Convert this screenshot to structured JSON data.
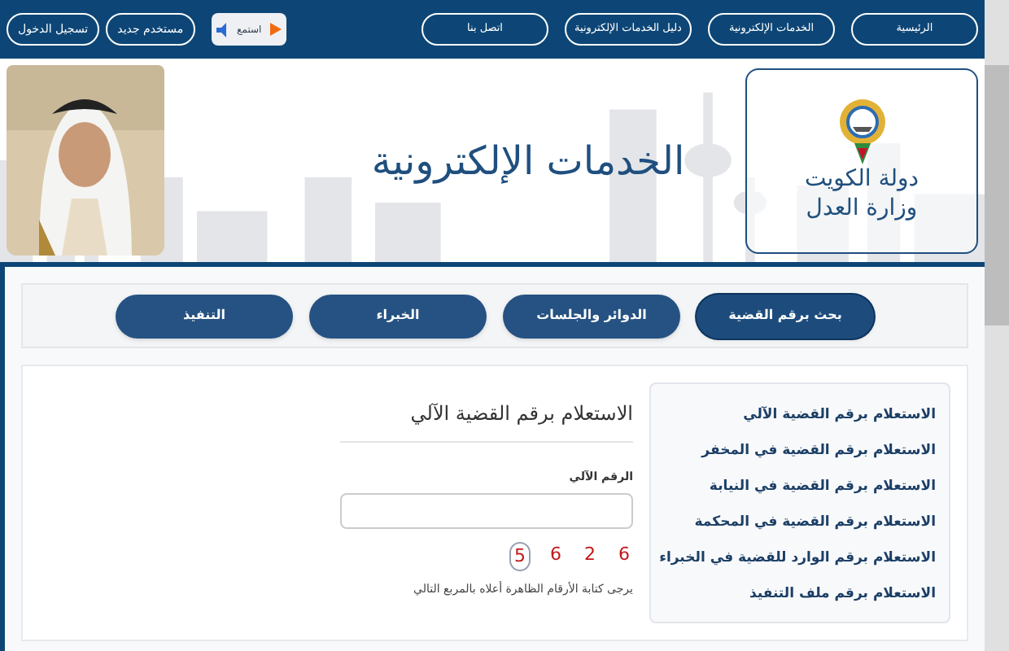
{
  "top_bar": {
    "nav": [
      "الرئيسية",
      "الخدمات الإلكترونية",
      "دليل الخدمات الإلكترونية",
      "اتصل بنا"
    ],
    "listen": "استمع",
    "account": [
      "مستخدم جديد",
      "تسجيل الدخول"
    ]
  },
  "header": {
    "logo_lines": [
      "دولة الكويت",
      "وزارة العدل"
    ],
    "title": "الخدمات الإلكترونية"
  },
  "tabs": [
    {
      "label": "بحث برقم القضية",
      "selected": true
    },
    {
      "label": "الدوائر والجلسات",
      "selected": false
    },
    {
      "label": "الخبراء",
      "selected": false
    },
    {
      "label": "التنفيذ",
      "selected": false
    }
  ],
  "sidebar": {
    "items": [
      "الاستعلام برقم القضية الآلي",
      "الاستعلام برقم القضية في المخفر",
      "الاستعلام برقم القضية في النيابة",
      "الاستعلام برقم القضية في المحكمة",
      "الاستعلام برقم الوارد للقضية في الخبراء",
      "الاستعلام برقم ملف التنفيذ"
    ]
  },
  "form": {
    "title": "الاستعلام برقم القضية الآلي",
    "field_label": "الرقم الآلي",
    "captcha": [
      "6",
      "2",
      "6",
      "5"
    ],
    "hint": "يرجى كتابة الأرقام الظاهرة أعلاه بالمربع التالي"
  }
}
